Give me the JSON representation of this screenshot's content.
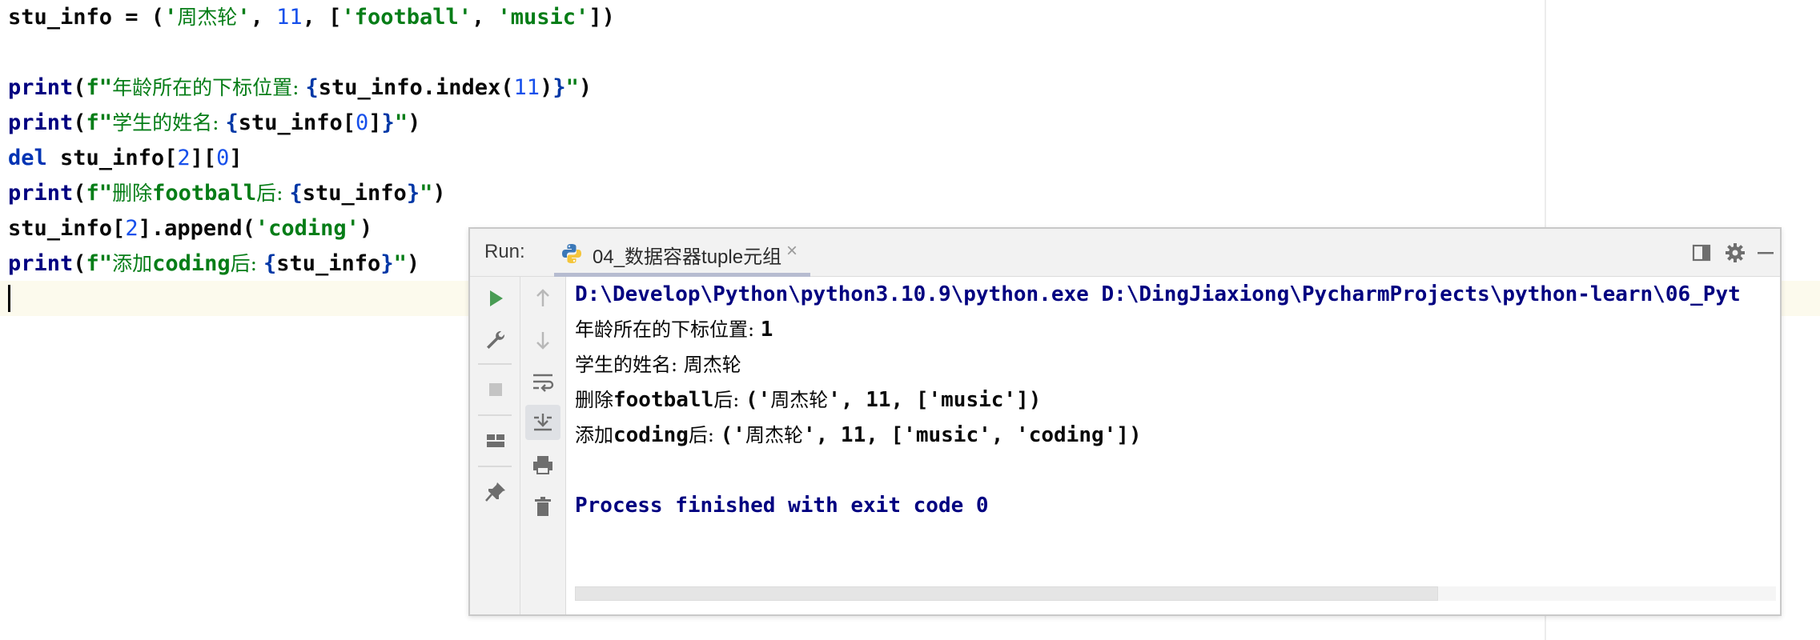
{
  "editor": {
    "lines": [
      {
        "key": "l1",
        "parts": [
          {
            "t": "stu_info = (",
            "c": "plain"
          },
          {
            "t": "'",
            "c": "str"
          },
          {
            "t": "周杰轮",
            "c": "cjk"
          },
          {
            "t": "'",
            "c": "str"
          },
          {
            "t": ", ",
            "c": "plain"
          },
          {
            "t": "11",
            "c": "num"
          },
          {
            "t": ", [",
            "c": "plain"
          },
          {
            "t": "'football'",
            "c": "str"
          },
          {
            "t": ", ",
            "c": "plain"
          },
          {
            "t": "'music'",
            "c": "str"
          },
          {
            "t": "])",
            "c": "plain"
          }
        ]
      },
      {
        "key": "l2",
        "parts": []
      },
      {
        "key": "l3",
        "parts": [
          {
            "t": "print",
            "c": "fn"
          },
          {
            "t": "(",
            "c": "plain"
          },
          {
            "t": "f\"",
            "c": "str"
          },
          {
            "t": "年龄所在的下标位置: ",
            "c": "cjk"
          },
          {
            "t": "{",
            "c": "br"
          },
          {
            "t": "stu_info.index(",
            "c": "plain"
          },
          {
            "t": "11",
            "c": "num"
          },
          {
            "t": ")",
            "c": "plain"
          },
          {
            "t": "}",
            "c": "br"
          },
          {
            "t": "\"",
            "c": "str"
          },
          {
            "t": ")",
            "c": "plain"
          }
        ]
      },
      {
        "key": "l4",
        "parts": [
          {
            "t": "print",
            "c": "fn"
          },
          {
            "t": "(",
            "c": "plain"
          },
          {
            "t": "f\"",
            "c": "str"
          },
          {
            "t": "学生的姓名: ",
            "c": "cjk"
          },
          {
            "t": "{",
            "c": "br"
          },
          {
            "t": "stu_info[",
            "c": "plain"
          },
          {
            "t": "0",
            "c": "num"
          },
          {
            "t": "]",
            "c": "plain"
          },
          {
            "t": "}",
            "c": "br"
          },
          {
            "t": "\"",
            "c": "str"
          },
          {
            "t": ")",
            "c": "plain"
          }
        ]
      },
      {
        "key": "l5",
        "parts": [
          {
            "t": "del",
            "c": "kw"
          },
          {
            "t": " stu_info[",
            "c": "plain"
          },
          {
            "t": "2",
            "c": "num"
          },
          {
            "t": "][",
            "c": "plain"
          },
          {
            "t": "0",
            "c": "num"
          },
          {
            "t": "]",
            "c": "plain"
          }
        ]
      },
      {
        "key": "l6",
        "parts": [
          {
            "t": "print",
            "c": "fn"
          },
          {
            "t": "(",
            "c": "plain"
          },
          {
            "t": "f\"",
            "c": "str"
          },
          {
            "t": "删除",
            "c": "cjk"
          },
          {
            "t": "football",
            "c": "str"
          },
          {
            "t": "后: ",
            "c": "cjk"
          },
          {
            "t": "{",
            "c": "br"
          },
          {
            "t": "stu_info",
            "c": "plain"
          },
          {
            "t": "}",
            "c": "br"
          },
          {
            "t": "\"",
            "c": "str"
          },
          {
            "t": ")",
            "c": "plain"
          }
        ]
      },
      {
        "key": "l7",
        "parts": [
          {
            "t": "stu_info[",
            "c": "plain"
          },
          {
            "t": "2",
            "c": "num"
          },
          {
            "t": "].append(",
            "c": "plain"
          },
          {
            "t": "'coding'",
            "c": "str"
          },
          {
            "t": ")",
            "c": "plain"
          }
        ]
      },
      {
        "key": "l8",
        "parts": [
          {
            "t": "print",
            "c": "fn"
          },
          {
            "t": "(",
            "c": "plain"
          },
          {
            "t": "f\"",
            "c": "str"
          },
          {
            "t": "添加",
            "c": "cjk"
          },
          {
            "t": "coding",
            "c": "str"
          },
          {
            "t": "后: ",
            "c": "cjk"
          },
          {
            "t": "{",
            "c": "br"
          },
          {
            "t": "stu_info",
            "c": "plain"
          },
          {
            "t": "}",
            "c": "br"
          },
          {
            "t": "\"",
            "c": "str"
          },
          {
            "t": ")",
            "c": "plain"
          }
        ]
      }
    ]
  },
  "run": {
    "label": "Run:",
    "tab_title": "04_数据容器tuple元组",
    "tab_close": "×",
    "icons": {
      "header": [
        "restore-layout-icon",
        "gear-icon",
        "minimize-icon"
      ],
      "left": [
        "rerun-icon",
        "wrench-icon",
        "stop-icon",
        "layout-icon",
        "pin-icon"
      ],
      "right": [
        "arrow-up-icon",
        "arrow-down-icon",
        "soft-wrap-icon",
        "scroll-to-end-icon",
        "print-icon",
        "trash-icon"
      ]
    },
    "colors": {
      "rerun": "#499c54",
      "console_path": "#000080",
      "header_bg": "#f2f2f2"
    },
    "console": [
      {
        "key": "c1",
        "blue": true,
        "parts": [
          {
            "t": "D:\\Develop\\Python\\python3.10.9\\python.exe D:\\DingJiaxiong\\PycharmProjects\\python-learn\\06_Pyt",
            "c": ""
          }
        ]
      },
      {
        "key": "c2",
        "blue": false,
        "parts": [
          {
            "t": "年龄所在的下标位置: ",
            "c": "cjk"
          },
          {
            "t": "1",
            "c": ""
          }
        ]
      },
      {
        "key": "c3",
        "blue": false,
        "parts": [
          {
            "t": "学生的姓名: 周杰轮",
            "c": "cjk"
          }
        ]
      },
      {
        "key": "c4",
        "blue": false,
        "parts": [
          {
            "t": "删除",
            "c": "cjk"
          },
          {
            "t": "football",
            "c": ""
          },
          {
            "t": "后: ",
            "c": "cjk"
          },
          {
            "t": "('",
            "c": ""
          },
          {
            "t": "周杰轮",
            "c": "cjk"
          },
          {
            "t": "', 11, ['music'])",
            "c": ""
          }
        ]
      },
      {
        "key": "c5",
        "blue": false,
        "parts": [
          {
            "t": "添加",
            "c": "cjk"
          },
          {
            "t": "coding",
            "c": ""
          },
          {
            "t": "后: ",
            "c": "cjk"
          },
          {
            "t": "('",
            "c": ""
          },
          {
            "t": "周杰轮",
            "c": "cjk"
          },
          {
            "t": "', 11, ['music', 'coding'])",
            "c": ""
          }
        ]
      },
      {
        "key": "c6",
        "blue": false,
        "parts": []
      },
      {
        "key": "c7",
        "blue": true,
        "parts": [
          {
            "t": "Process finished with exit code 0",
            "c": ""
          }
        ]
      }
    ]
  }
}
